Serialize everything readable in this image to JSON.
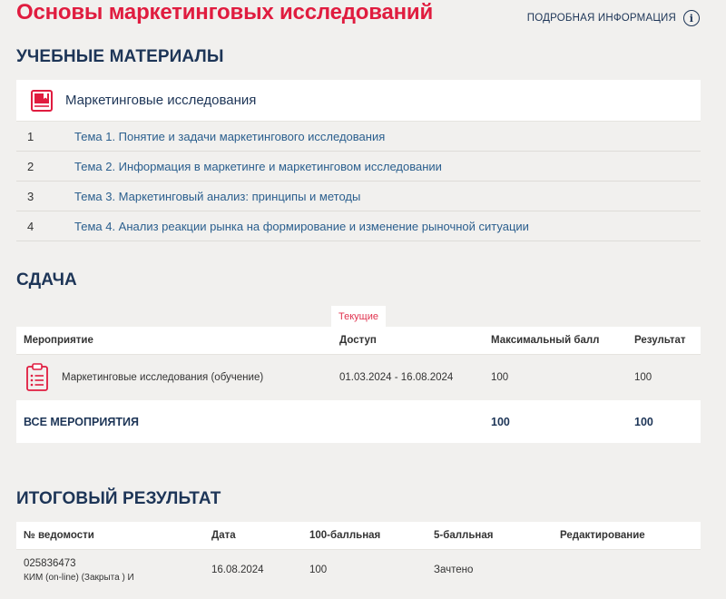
{
  "page": {
    "title": "Основы маркетинговых исследований",
    "more_info": "ПОДРОБНАЯ ИНФОРМАЦИЯ",
    "info_icon": "info-circle-icon",
    "accent_color": "#e01c3f",
    "heading_color": "#1d3557"
  },
  "materials": {
    "title": "УЧЕБНЫЕ МАТЕРИАЛЫ",
    "course": {
      "name": "Маркетинговые исследования",
      "icon": "book-icon"
    },
    "topics": [
      {
        "num": "1",
        "label": "Тема 1. Понятие и задачи маркетингового исследования"
      },
      {
        "num": "2",
        "label": "Тема 2. Информация в маркетинге и маркетинговом исследовании"
      },
      {
        "num": "3",
        "label": "Тема 3. Маркетинговый анализ: принципы и методы"
      },
      {
        "num": "4",
        "label": "Тема 4. Анализ реакции рынка на формирование и изменение рыночной ситуации"
      }
    ]
  },
  "submission": {
    "title": "СДАЧА",
    "tab": "Текущие",
    "headers": [
      "Мероприятие",
      "Доступ",
      "Максимальный балл",
      "Результат"
    ],
    "rows": [
      {
        "name": "Маркетинговые исследования (обучение)",
        "access": "01.03.2024 - 16.08.2024",
        "max": "100",
        "result": "100",
        "icon": "clipboard-icon"
      }
    ],
    "total": {
      "label": "ВСЕ МЕРОПРИЯТИЯ",
      "max": "100",
      "result": "100"
    }
  },
  "final": {
    "title": "ИТОГОВЫЙ РЕЗУЛЬТАТ",
    "headers": [
      "№ ведомости",
      "Дата",
      "100-балльная",
      "5-балльная",
      "Редактирование"
    ],
    "rows": [
      {
        "number": "025836473",
        "note": "КИМ (on-line) (Закрыта ) И",
        "date": "16.08.2024",
        "score100": "100",
        "score5": "Зачтено",
        "edit": ""
      }
    ]
  }
}
